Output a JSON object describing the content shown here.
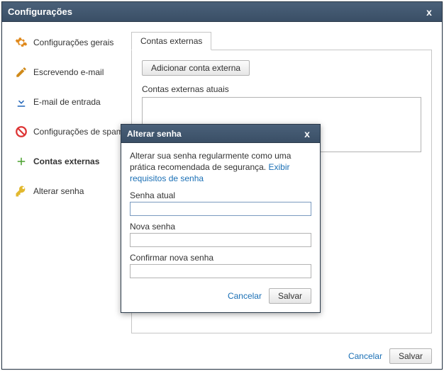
{
  "colors": {
    "accent": "#3f5871",
    "link": "#1a6fb5",
    "border": "#c6c6c6"
  },
  "window": {
    "title": "Configurações",
    "close_x": "x"
  },
  "sidebar": {
    "items": [
      {
        "label": "Configurações gerais",
        "icon": "gear-icon"
      },
      {
        "label": "Escrevendo e-mail",
        "icon": "pencil-icon"
      },
      {
        "label": "E-mail de entrada",
        "icon": "download-icon"
      },
      {
        "label": "Configurações de spam",
        "icon": "block-icon"
      },
      {
        "label": "Contas externas",
        "icon": "plus-icon",
        "active": true
      },
      {
        "label": "Alterar senha",
        "icon": "key-icon"
      }
    ]
  },
  "main": {
    "tab_label": "Contas externas",
    "add_button": "Adicionar conta externa",
    "list_label": "Contas externas atuais"
  },
  "footer": {
    "cancel": "Cancelar",
    "save": "Salvar"
  },
  "modal": {
    "title": "Alterar senha",
    "close_x": "x",
    "description": "Alterar sua senha regularmente como uma prática recomendada de segurança.",
    "requirements_link": "Exibir requisitos de senha",
    "fields": {
      "current_label": "Senha atual",
      "current_value": "",
      "new_label": "Nova senha",
      "new_value": "",
      "confirm_label": "Confirmar nova senha",
      "confirm_value": ""
    },
    "cancel": "Cancelar",
    "save": "Salvar"
  }
}
